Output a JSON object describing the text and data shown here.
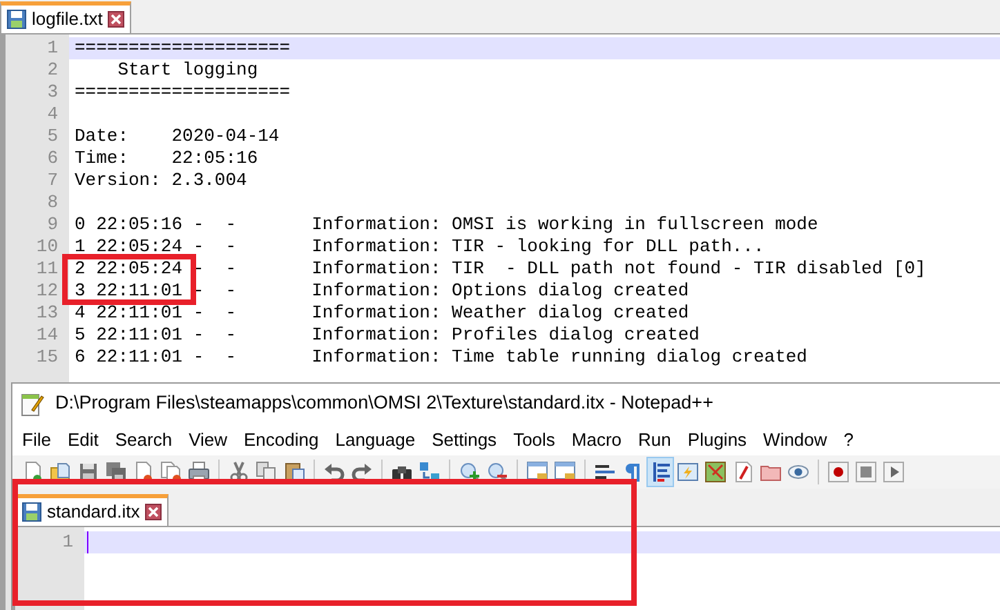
{
  "back_window": {
    "tab": {
      "label": "logfile.txt",
      "selected": true
    },
    "lines": [
      {
        "number": "1",
        "text": "====================",
        "current": true,
        "marked": false
      },
      {
        "number": "2",
        "text": "    Start logging",
        "current": false,
        "marked": false
      },
      {
        "number": "3",
        "text": "====================",
        "current": false,
        "marked": false
      },
      {
        "number": "4",
        "current": false,
        "marked": false
      },
      {
        "number": "5",
        "text": "Date:    2020-04-14",
        "current": false,
        "marked": false
      },
      {
        "number": "6",
        "text": "Time:    22:05:16",
        "current": false,
        "marked": false
      },
      {
        "number": "7",
        "text": "Version: 2.3.004",
        "current": false,
        "marked": false
      },
      {
        "number": "8",
        "current": false,
        "marked": false
      },
      {
        "number": "9",
        "text": "0 22:05:16 -  -       Information: OMSI is working in fullscreen mode",
        "current": false,
        "marked": false
      },
      {
        "number": "10",
        "text": "1 22:05:24 -  -       Information: TIR - looking for DLL path...",
        "current": false,
        "marked": false
      },
      {
        "number": "11",
        "text": "2 22:05:24 -  -       Information: TIR  - DLL path not found - TIR disabled [0]",
        "current": false,
        "marked": true
      },
      {
        "number": "12",
        "text": "3 22:11:01 -  -       Information: Options dialog created",
        "current": false,
        "marked": true
      },
      {
        "number": "13",
        "text": "4 22:11:01 -  -       Information: Weather dialog created",
        "current": false,
        "marked": false
      },
      {
        "number": "14",
        "text": "5 22:11:01 -  -       Information: Profiles dialog created",
        "current": false,
        "marked": false
      },
      {
        "number": "15",
        "text": "6 22:11:01 -  -       Information: Time table running dialog created",
        "current": false,
        "marked": false
      }
    ]
  },
  "front_window": {
    "title": "D:\\Program Files\\steamapps\\common\\OMSI 2\\Texture\\standard.itx - Notepad++",
    "menu": [
      "File",
      "Edit",
      "Search",
      "View",
      "Encoding",
      "Language",
      "Settings",
      "Tools",
      "Macro",
      "Run",
      "Plugins",
      "Window",
      "?"
    ],
    "toolbar": [
      {
        "kind": "new",
        "selected": false
      },
      {
        "kind": "open",
        "selected": false
      },
      {
        "kind": "save",
        "selected": false
      },
      {
        "kind": "saveall",
        "selected": false
      },
      {
        "kind": "close",
        "selected": false
      },
      {
        "kind": "closeall",
        "selected": false
      },
      {
        "kind": "print",
        "selected": false
      },
      {
        "kind": "separator"
      },
      {
        "kind": "cut",
        "selected": false
      },
      {
        "kind": "copy",
        "selected": false
      },
      {
        "kind": "paste",
        "selected": false
      },
      {
        "kind": "separator"
      },
      {
        "kind": "undo",
        "selected": false
      },
      {
        "kind": "redo",
        "selected": false
      },
      {
        "kind": "separator"
      },
      {
        "kind": "find",
        "selected": false
      },
      {
        "kind": "replace",
        "selected": false
      },
      {
        "kind": "separator"
      },
      {
        "kind": "zoomin",
        "selected": false
      },
      {
        "kind": "zoomout",
        "selected": false
      },
      {
        "kind": "separator"
      },
      {
        "kind": "syncv",
        "selected": false
      },
      {
        "kind": "synch",
        "selected": false
      },
      {
        "kind": "separator"
      },
      {
        "kind": "wrap",
        "selected": false
      },
      {
        "kind": "allchars",
        "selected": false
      },
      {
        "kind": "indent",
        "selected": true
      },
      {
        "kind": "udl",
        "selected": false
      },
      {
        "kind": "docmap",
        "selected": false
      },
      {
        "kind": "funclist",
        "selected": false
      },
      {
        "kind": "folder",
        "selected": false
      },
      {
        "kind": "monitor",
        "selected": false
      },
      {
        "kind": "separator"
      },
      {
        "kind": "record",
        "selected": false
      },
      {
        "kind": "stop",
        "selected": false
      },
      {
        "kind": "play",
        "selected": false
      }
    ],
    "tab": {
      "label": "standard.itx",
      "selected": true
    },
    "lines": [
      {
        "number": "1",
        "current": true
      }
    ],
    "marked": true
  }
}
